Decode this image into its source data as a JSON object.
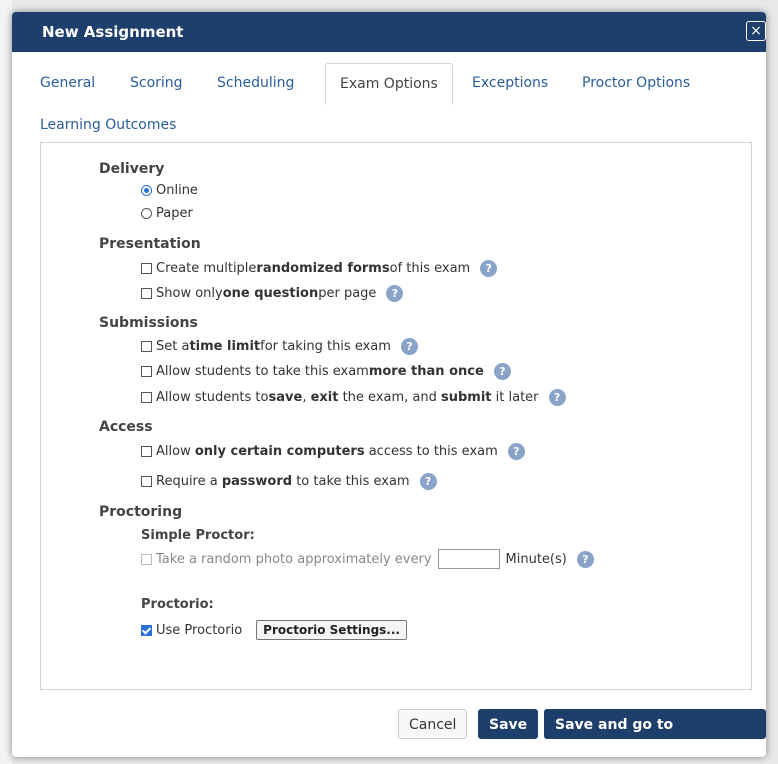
{
  "dialog": {
    "title": "New Assignment",
    "close_icon": "×"
  },
  "tabs": [
    {
      "label": "General"
    },
    {
      "label": "Scoring"
    },
    {
      "label": "Scheduling"
    },
    {
      "label": "Exam Options",
      "active": true
    },
    {
      "label": "Exceptions"
    },
    {
      "label": "Proctor Options"
    },
    {
      "label": "Learning Outcomes"
    }
  ],
  "delivery": {
    "title": "Delivery",
    "online": "Online",
    "paper": "Paper"
  },
  "presentation": {
    "title": "Presentation",
    "randomized": {
      "pre": "Create multiple ",
      "bold": "randomized forms",
      "post": " of this exam"
    },
    "one_question": {
      "pre": "Show only ",
      "bold": "one question",
      "post": " per page"
    }
  },
  "submissions": {
    "title": "Submissions",
    "time_limit": {
      "pre": "Set a ",
      "bold": "time limit",
      "post": " for taking this exam"
    },
    "more_than_once": {
      "pre": "Allow students to take this exam ",
      "bold": "more than once"
    },
    "save_exit": {
      "pre": "Allow students to ",
      "bold1": "save",
      "mid1": ", ",
      "bold2": "exit",
      "mid2": " the exam, and ",
      "bold3": "submit",
      "post": " it later"
    }
  },
  "access": {
    "title": "Access",
    "computers": {
      "pre": "Allow ",
      "bold": "only certain computers",
      "post": " access to this exam"
    },
    "password": {
      "pre": "Require a ",
      "bold": "password",
      "post": " to take this exam"
    }
  },
  "proctoring": {
    "title": "Proctoring",
    "simple_title": "Simple Proctor:",
    "photo_pre": "Take a random photo approximately every",
    "photo_post": "Minute(s)",
    "minutes_value": "",
    "proctorio_title": "Proctorio:",
    "use_proctorio": "Use Proctorio",
    "settings_button": "Proctorio Settings..."
  },
  "footer": {
    "cancel": "Cancel",
    "save": "Save",
    "save_go": "Save and go to Questions"
  },
  "colors": {
    "titlebar": "#1e3f6b",
    "tab_link": "#2a5d9c",
    "help_icon": "#8aa3c9",
    "checked": "#2b72d7"
  }
}
